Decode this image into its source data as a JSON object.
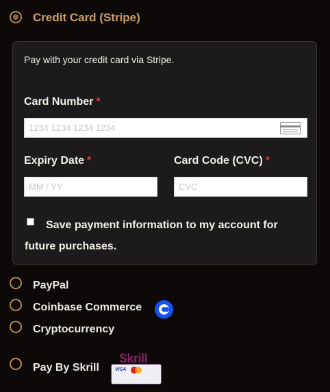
{
  "payment_methods": {
    "selected": "credit_card",
    "credit_card": {
      "label": "Credit Card (Stripe)",
      "description": "Pay with your credit card via Stripe.",
      "card_number": {
        "label": "Card Number",
        "required_mark": "*",
        "placeholder": "1234 1234 1234 1234",
        "value": ""
      },
      "expiry": {
        "label": "Expiry Date",
        "required_mark": "*",
        "placeholder": "MM / YY",
        "value": ""
      },
      "cvc": {
        "label": "Card Code (CVC)",
        "required_mark": "*",
        "placeholder": "CVC",
        "value": ""
      },
      "save_info": {
        "label": "Save payment information to my account for future purchases.",
        "checked": false
      }
    },
    "paypal": {
      "label": "PayPal"
    },
    "coinbase": {
      "label": "Coinbase Commerce",
      "logo_icon": "coinbase-logo-icon"
    },
    "crypto": {
      "label": "Cryptocurrency"
    },
    "skrill": {
      "label": "Pay By Skrill",
      "logo_text": "Skrill",
      "logo_icon": "skrill-logo-icon"
    }
  },
  "colors": {
    "background": "#0d0909",
    "panel": "#1c1a1a",
    "accent_gold": "#c9a06a",
    "radio_border": "#b88a52",
    "required_red": "#e03b3b",
    "coinbase_blue": "#1652f0",
    "skrill_purple": "#862165"
  }
}
